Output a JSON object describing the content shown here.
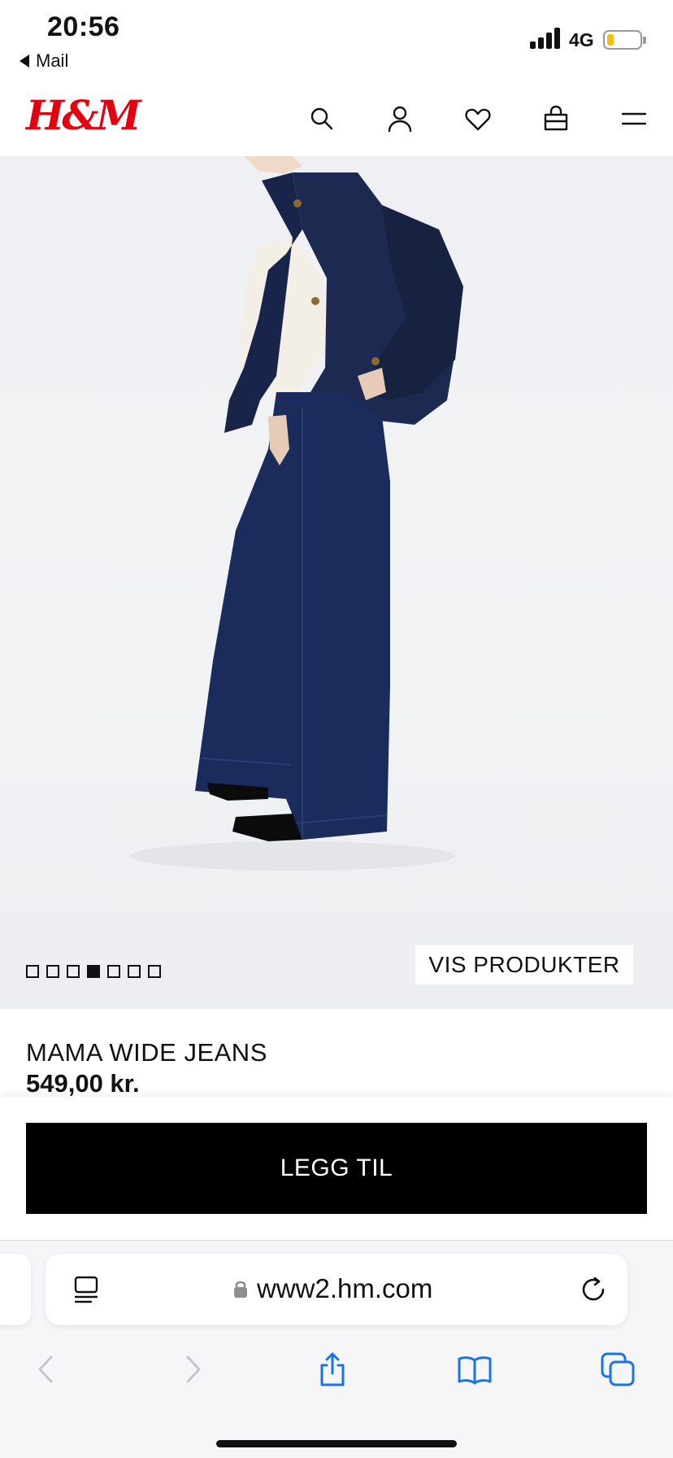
{
  "status_bar": {
    "time": "20:56",
    "back_app": "Mail",
    "network": "4G",
    "signal_bars": 4,
    "battery_level": 0.2,
    "battery_color": "#f4c00d"
  },
  "header": {
    "logo_text": "H&M",
    "logo_color": "#e50010",
    "icons": [
      "search-icon",
      "account-icon",
      "favorites-icon",
      "bag-icon",
      "menu-icon"
    ]
  },
  "gallery": {
    "image_count": 7,
    "active_index": 3,
    "vis_produkter_label": "VIS PRODUKTER"
  },
  "product": {
    "name": "MAMA WIDE JEANS",
    "price": "549,00 kr."
  },
  "cta": {
    "add_label": "LEGG TIL"
  },
  "browser": {
    "url": "www2.hm.com",
    "accent_color": "#1a73e8",
    "nav_icons": [
      "back-icon",
      "forward-icon",
      "share-icon",
      "bookmarks-icon",
      "tabs-icon"
    ]
  }
}
